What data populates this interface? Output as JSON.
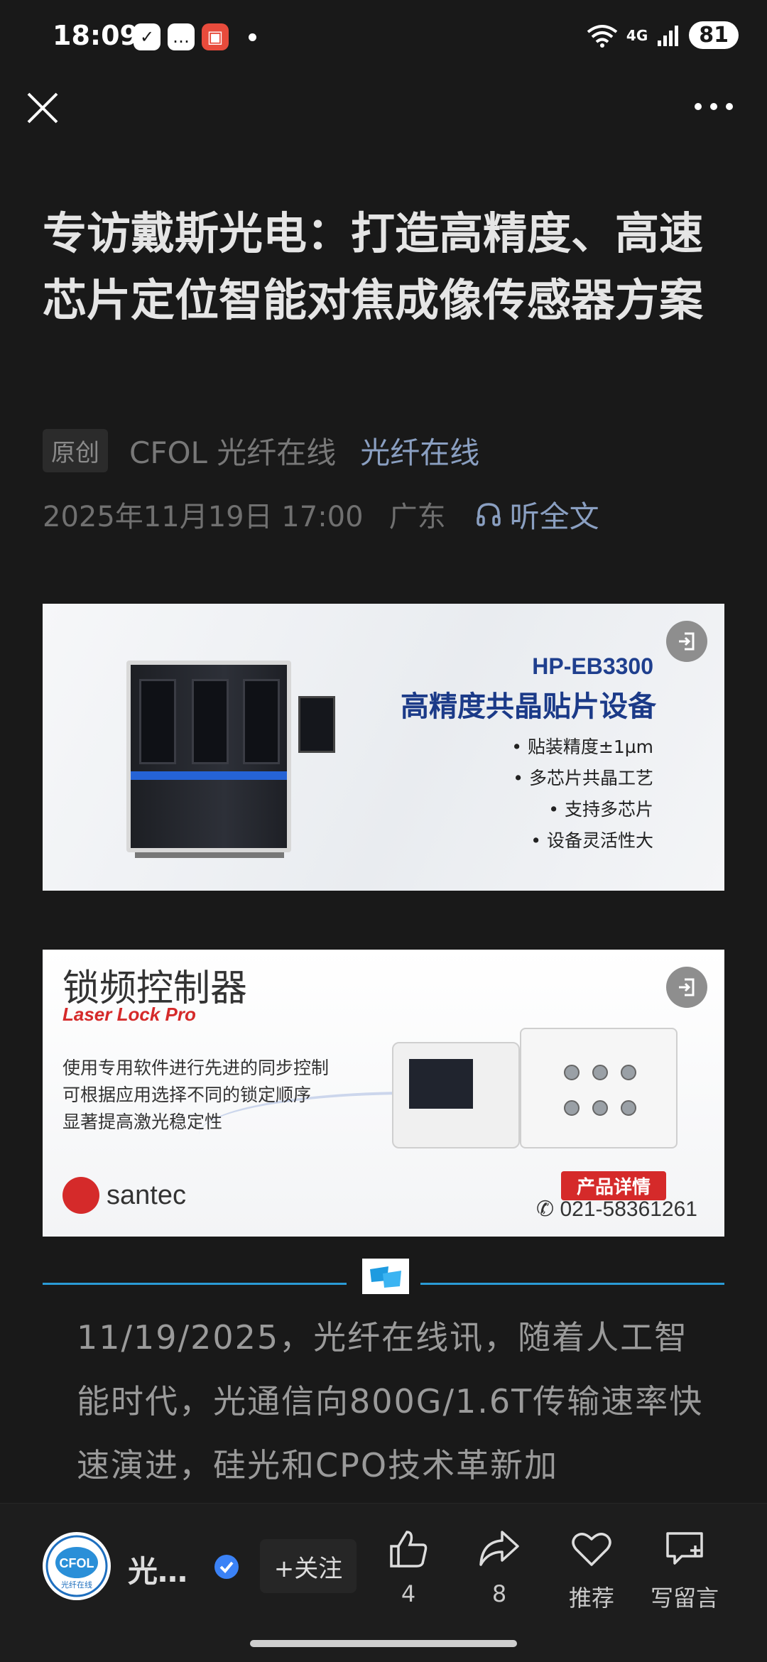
{
  "status_bar": {
    "time": "18:09",
    "network": "4G",
    "battery": "81",
    "notification_icons": [
      "check-chat-icon",
      "message-icon",
      "app-icon"
    ]
  },
  "article": {
    "title": "专访戴斯光电：打造高精度、高速芯片定位智能对焦成像传感器方案",
    "badge": "原创",
    "author": "CFOL 光纤在线",
    "account": "光纤在线",
    "date": "2025年11月19日 17:00",
    "region": "广东",
    "listen_label": "听全文",
    "body_text": "11/19/2025，光纤在线讯，随着人工智能时代，光通信向800G/1.6T传输速率快速演进，硅光和CPO技术革新加"
  },
  "ads": {
    "ad1": {
      "model": "HP-EB3300",
      "headline": "高精度共晶贴片设备",
      "bullets": [
        "• 贴装精度±1µm",
        "• 多芯片共晶工艺",
        "• 支持多芯片",
        "• 设备灵活性大"
      ]
    },
    "ad2": {
      "title": "锁频控制器",
      "subtitle": "Laser Lock Pro",
      "desc": [
        "使用专用软件进行先进的同步控制",
        "可根据应用选择不同的锁定顺序",
        "显著提高激光稳定性"
      ],
      "brand": "santec",
      "cta": "产品详情",
      "phone": "021-58361261"
    }
  },
  "bottom_bar": {
    "account_name": "光…",
    "follow_label": "+关注",
    "like_count": "4",
    "share_count": "8",
    "recommend_label": "推荐",
    "comment_label": "写留言"
  },
  "colors": {
    "background": "#191919",
    "link": "#8a9fc1",
    "divider": "#2a9bd6",
    "verify": "#3b82f6"
  }
}
